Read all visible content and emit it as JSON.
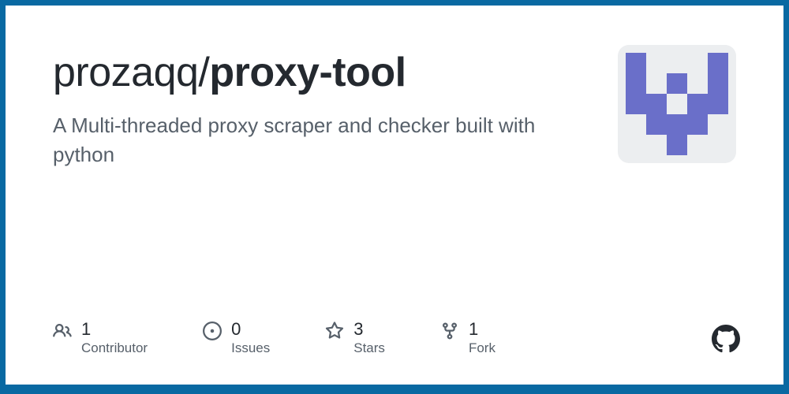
{
  "repo": {
    "owner": "prozaqq",
    "separator": "/",
    "name": "proxy-tool",
    "description": "A Multi-threaded proxy scraper and checker built with python"
  },
  "stats": {
    "contributors": {
      "value": "1",
      "label": "Contributor"
    },
    "issues": {
      "value": "0",
      "label": "Issues"
    },
    "stars": {
      "value": "3",
      "label": "Stars"
    },
    "forks": {
      "value": "1",
      "label": "Fork"
    }
  },
  "colors": {
    "border": "#0969a2",
    "identicon": "#6a6fc9"
  }
}
